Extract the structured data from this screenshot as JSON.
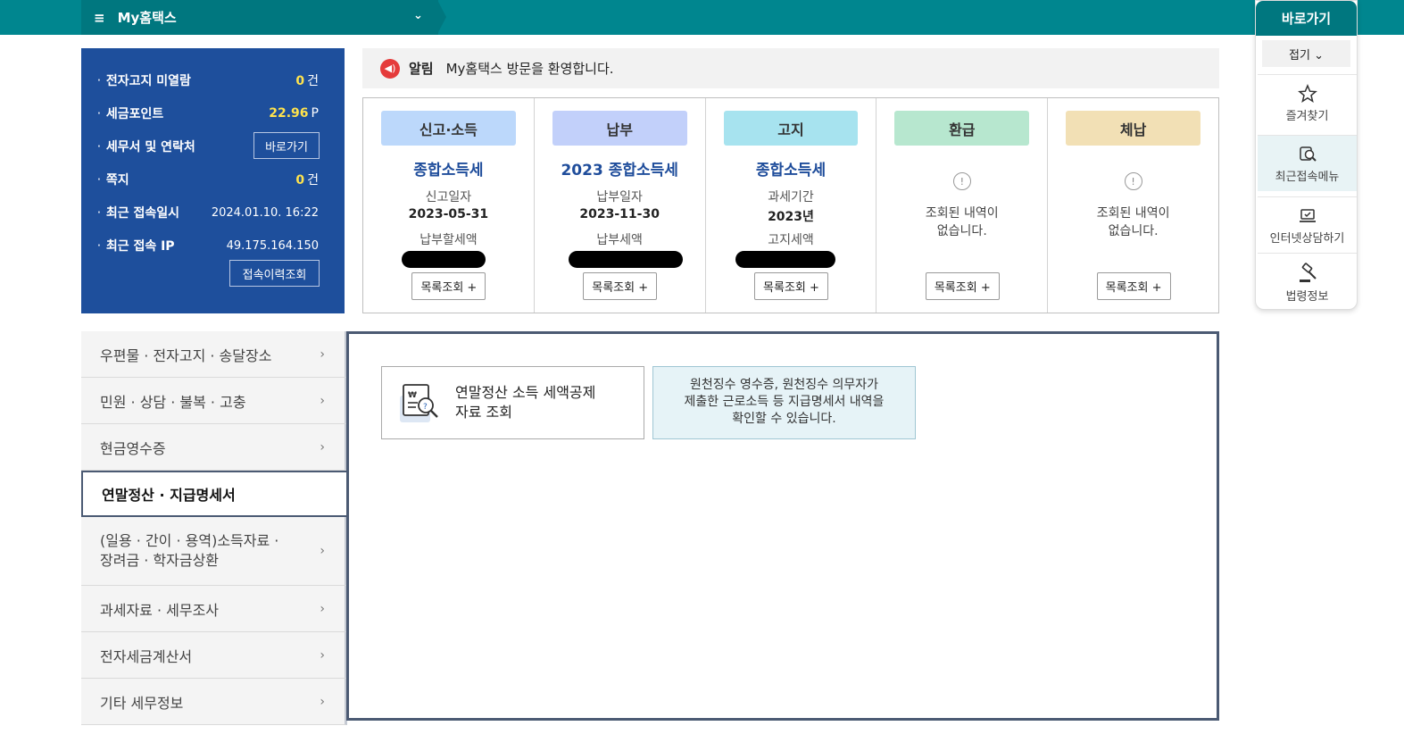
{
  "topbar": {
    "menu_icon": "≡",
    "title": "My홈택스",
    "dropdown_icon": "⌄"
  },
  "info": {
    "unread_label": "전자고지 미열람",
    "unread_value": "0",
    "unread_unit": "건",
    "points_label": "세금포인트",
    "points_value": "22.96",
    "points_unit": "P",
    "office_label": "세무서 및 연락처",
    "office_button": "바로가기",
    "memo_label": "쪽지",
    "memo_value": "0",
    "memo_unit": "건",
    "last_login_label": "최근 접속일시",
    "last_login_value": "2024.01.10.  16:22",
    "last_ip_label": "최근 접속 IP",
    "last_ip_value": "49.175.164.150",
    "history_button": "접속이력조회"
  },
  "notice": {
    "label": "알림",
    "text": "My홈택스 방문을 환영합니다."
  },
  "status": {
    "list_button": "목록조회 +",
    "cols": [
      {
        "head": "신고·소득",
        "head_color": "#bcd8fb",
        "title": "종합소득세",
        "label1": "신고일자",
        "value1": "2023-05-31",
        "label2": "납부할세액"
      },
      {
        "head": "납부",
        "head_color": "#c2d0fa",
        "title": "2023 종합소득세",
        "label1": "납부일자",
        "value1": "2023-11-30",
        "label2": "납부세액"
      },
      {
        "head": "고지",
        "head_color": "#a7e3ef",
        "title": "종합소득세",
        "label1": "과세기간",
        "value1": "2023년",
        "label2": "고지세액"
      },
      {
        "head": "환급",
        "head_color": "#b7e7cf",
        "empty_line1": "조회된 내역이",
        "empty_line2": "없습니다."
      },
      {
        "head": "체납",
        "head_color": "#f2e0b5",
        "empty_line1": "조회된 내역이",
        "empty_line2": "없습니다."
      }
    ]
  },
  "side_menu": [
    {
      "line1": "우편물 · 전자고지 · 송달장소"
    },
    {
      "line1": "민원 · 상담 · 불복 · 고충"
    },
    {
      "line1": "현금영수증"
    },
    {
      "line1": "연말정산 · 지급명세서"
    },
    {
      "line1": "(일용 · 간이 · 용역)소득자료 ·",
      "line2": "장려금 · 학자금상환"
    },
    {
      "line1": "과세자료 · 세무조사"
    },
    {
      "line1": "전자세금계산서"
    },
    {
      "line1": "기타 세무정보"
    }
  ],
  "content": {
    "card_title_line1": "연말정산 소득 세액공제",
    "card_title_line2": "자료 조회",
    "desc_line1": "원천징수 영수증, 원천징수 의무자가",
    "desc_line2": "제출한 근로소득 등 지급명세서 내역을",
    "desc_line3": "확인할 수 있습니다."
  },
  "quick": {
    "title": "바로가기",
    "fold": "접기 ⌄",
    "items": [
      "즐겨찾기",
      "최근접속메뉴",
      "인터넷상담하기",
      "법령정보"
    ]
  },
  "chevron": "›"
}
